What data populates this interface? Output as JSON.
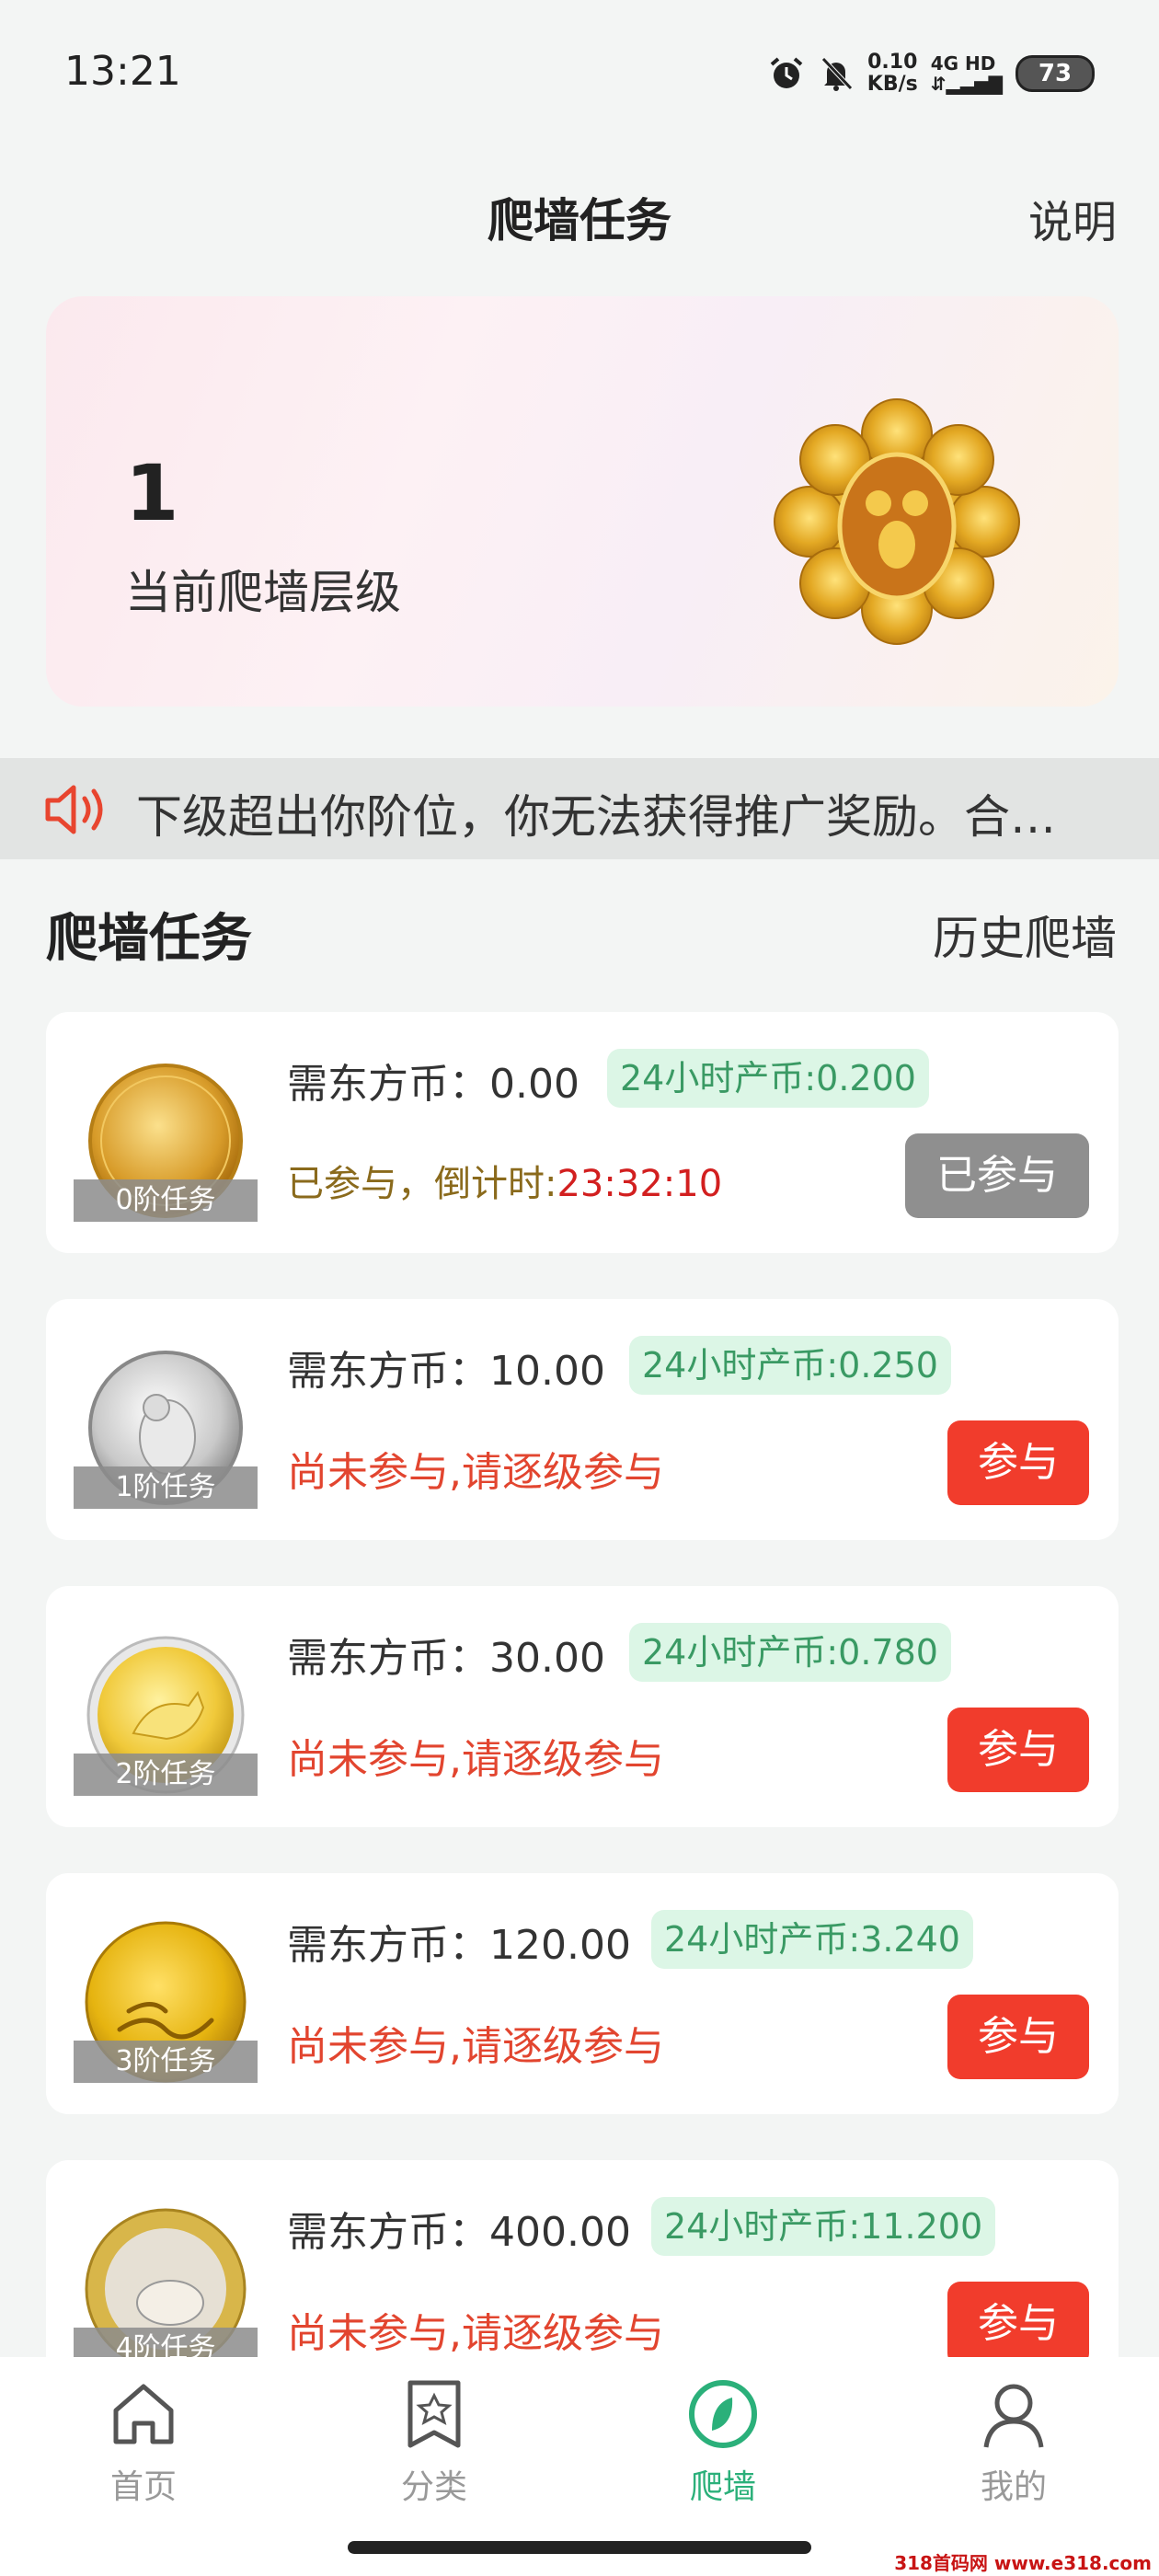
{
  "status_bar": {
    "time": "13:21",
    "net_speed_value": "0.10",
    "net_speed_unit": "KB/s",
    "network": "4G HD",
    "battery": "73"
  },
  "nav": {
    "title": "爬墙任务",
    "help": "说明"
  },
  "banner": {
    "level": "1",
    "level_label": "当前爬墙层级"
  },
  "notice": {
    "text": "下级超出你阶位，你无法获得推广奖励。合…"
  },
  "section": {
    "title": "爬墙任务",
    "history": "历史爬墙"
  },
  "tasks": [
    {
      "coin_label": "0阶任务",
      "need": "需东方币：0.00",
      "output": "24小时产币:0.200",
      "status_prefix": "已参与，倒计时:",
      "countdown": [
        "23",
        "32",
        "10"
      ],
      "button": "已参与"
    },
    {
      "coin_label": "1阶任务",
      "need": "需东方币：10.00",
      "output": "24小时产币:0.250",
      "status": "尚未参与,请逐级参与",
      "button": "参与"
    },
    {
      "coin_label": "2阶任务",
      "need": "需东方币：30.00",
      "output": "24小时产币:0.780",
      "status": "尚未参与,请逐级参与",
      "button": "参与"
    },
    {
      "coin_label": "3阶任务",
      "need": "需东方币：120.00",
      "output": "24小时产币:3.240",
      "status": "尚未参与,请逐级参与",
      "button": "参与"
    },
    {
      "coin_label": "4阶任务",
      "need": "需东方币：400.00",
      "output": "24小时产币:11.200",
      "status": "尚未参与,请逐级参与",
      "button": "参与"
    }
  ],
  "tabbar": {
    "items": [
      {
        "label": "首页",
        "icon": "home-icon"
      },
      {
        "label": "分类",
        "icon": "category-icon"
      },
      {
        "label": "爬墙",
        "icon": "climb-icon"
      },
      {
        "label": "我的",
        "icon": "user-icon"
      }
    ],
    "active": "爬墙"
  },
  "watermark": "318首码网 www.e318.com",
  "colors": {
    "accent_green": "#2bb07a",
    "join_red": "#f13c2c",
    "joined_gray": "#8f8f8f"
  }
}
